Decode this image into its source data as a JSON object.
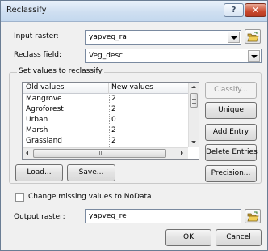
{
  "window": {
    "title": "Reclassify",
    "help_label": "?",
    "close_label": "✕"
  },
  "input_raster": {
    "label": "Input raster:",
    "value": "yapveg_ra"
  },
  "reclass_field": {
    "label": "Reclass field:",
    "value": "Veg_desc"
  },
  "values_group": {
    "title": "Set values to reclassify",
    "columns": [
      "Old values",
      "New values"
    ],
    "rows": [
      {
        "old": "Mangrove",
        "new": "2"
      },
      {
        "old": "Agroforest",
        "new": "2"
      },
      {
        "old": "Urban",
        "new": "0"
      },
      {
        "old": "Marsh",
        "new": "2"
      },
      {
        "old": "Grassland",
        "new": "2"
      }
    ],
    "hscroll_grip": "III",
    "buttons": {
      "classify": "Classify...",
      "unique": "Unique",
      "add_entry": "Add Entry",
      "delete_entries": "Delete Entries",
      "load": "Load...",
      "save": "Save...",
      "precision": "Precision..."
    }
  },
  "nodata_option": {
    "label": "Change missing values to NoData",
    "checked": false
  },
  "output_raster": {
    "label": "Output raster:",
    "value": "yapveg_re"
  },
  "footer": {
    "ok": "OK",
    "cancel": "Cancel"
  },
  "icons": {
    "browse": "folder-open-icon",
    "dropdown": "chevron-down-icon"
  }
}
